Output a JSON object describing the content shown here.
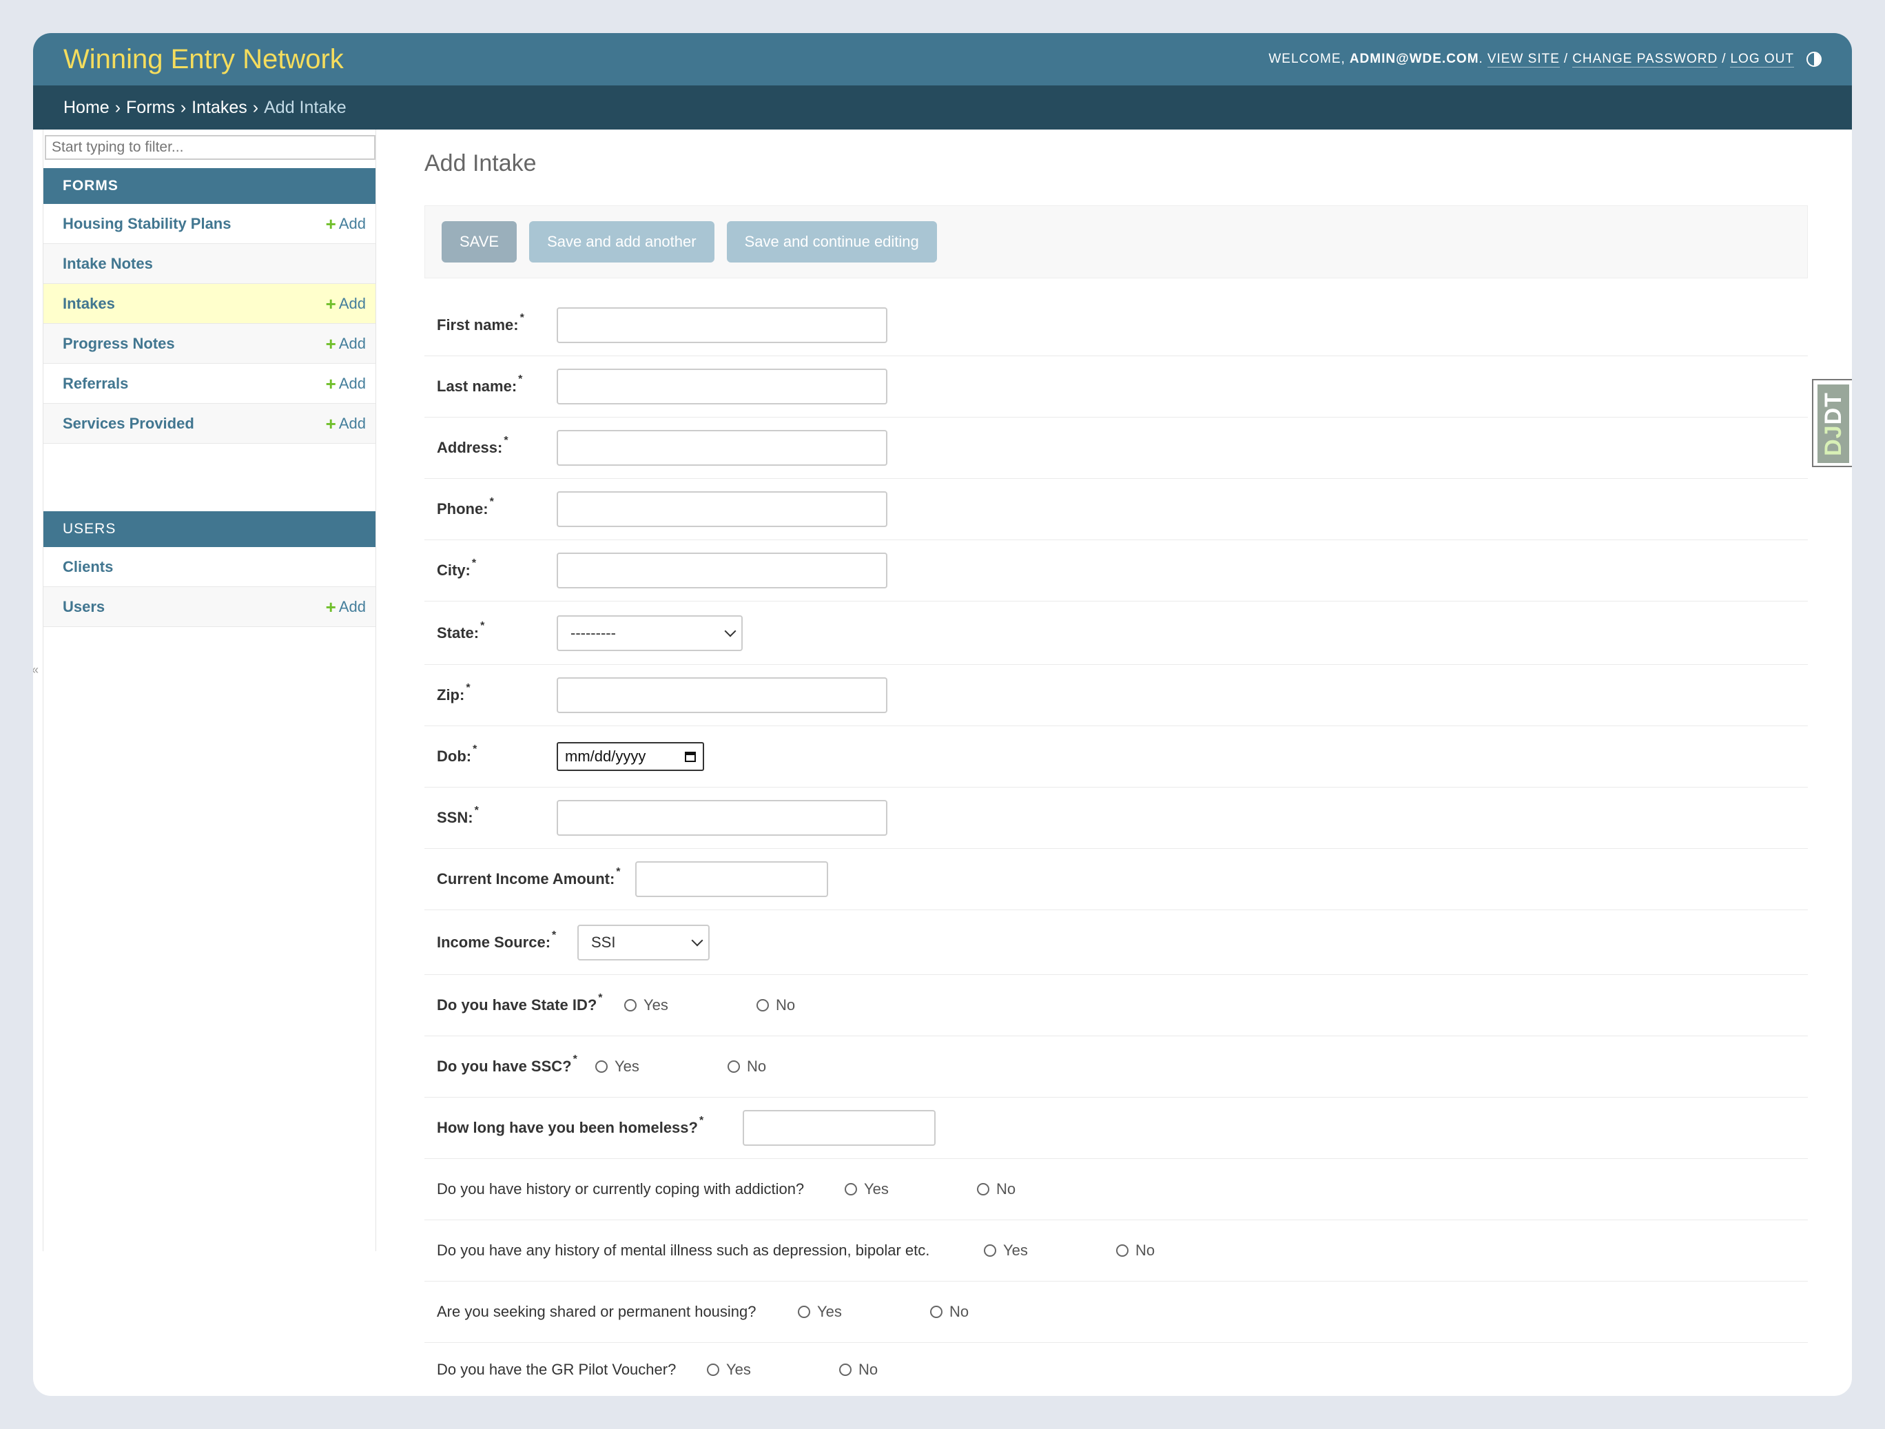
{
  "header": {
    "brand": "Winning Entry Network",
    "welcome": "WELCOME,",
    "username": "ADMIN@WDE.COM",
    "period": ".",
    "view_site": "VIEW SITE",
    "change_password": "CHANGE PASSWORD",
    "log_out": "LOG OUT",
    "sep": "/"
  },
  "breadcrumbs": {
    "home": "Home",
    "forms": "Forms",
    "intakes": "Intakes",
    "current": "Add Intake",
    "sep": "›"
  },
  "sidebar": {
    "filter_placeholder": "Start typing to filter...",
    "add_label": "Add",
    "forms_caption": "FORMS",
    "forms_items": [
      {
        "label": "Housing Stability Plans",
        "has_add": true
      },
      {
        "label": "Intake Notes",
        "has_add": false
      },
      {
        "label": "Intakes",
        "has_add": true,
        "current": true
      },
      {
        "label": "Progress Notes",
        "has_add": true
      },
      {
        "label": "Referrals",
        "has_add": true
      },
      {
        "label": "Services Provided",
        "has_add": true
      }
    ],
    "users_caption": "USERS",
    "users_items": [
      {
        "label": "Clients",
        "has_add": false
      },
      {
        "label": "Users",
        "has_add": true
      }
    ]
  },
  "main": {
    "title": "Add Intake",
    "buttons": {
      "save": "SAVE",
      "save_add_another": "Save and add another",
      "save_continue": "Save and continue editing"
    },
    "fields": {
      "first_name": "First name:",
      "last_name": "Last name:",
      "address": "Address:",
      "phone": "Phone:",
      "city": "City:",
      "state": "State:",
      "state_value": "---------",
      "zip": "Zip:",
      "dob": "Dob:",
      "dob_placeholder": "mm/dd/yyyy",
      "ssn": "SSN:",
      "income_amount": "Current Income Amount:",
      "income_source": "Income Source:",
      "income_source_value": "SSI",
      "state_id": "Do you have State ID?",
      "ssc": "Do you have SSC?",
      "homeless": "How long have you been homeless?",
      "addiction": "Do you have history or currently coping with addiction?",
      "mental_illness": "Do you have any history of mental illness such as depression, bipolar etc.",
      "housing": "Are you seeking shared or permanent housing?",
      "gr_voucher": "Do you have the GR Pilot Voucher?"
    },
    "required_mark": "*",
    "yes": "Yes",
    "no": "No"
  },
  "djdt": {
    "prefix": "DJ",
    "suffix": "DT"
  },
  "collapse_glyph": "«",
  "colors": {
    "header": "#417690",
    "breadcrumbs": "#264b5d",
    "brand": "#f5dd5d",
    "current_row": "#ffffcc",
    "add_plus": "#70bf2b"
  }
}
